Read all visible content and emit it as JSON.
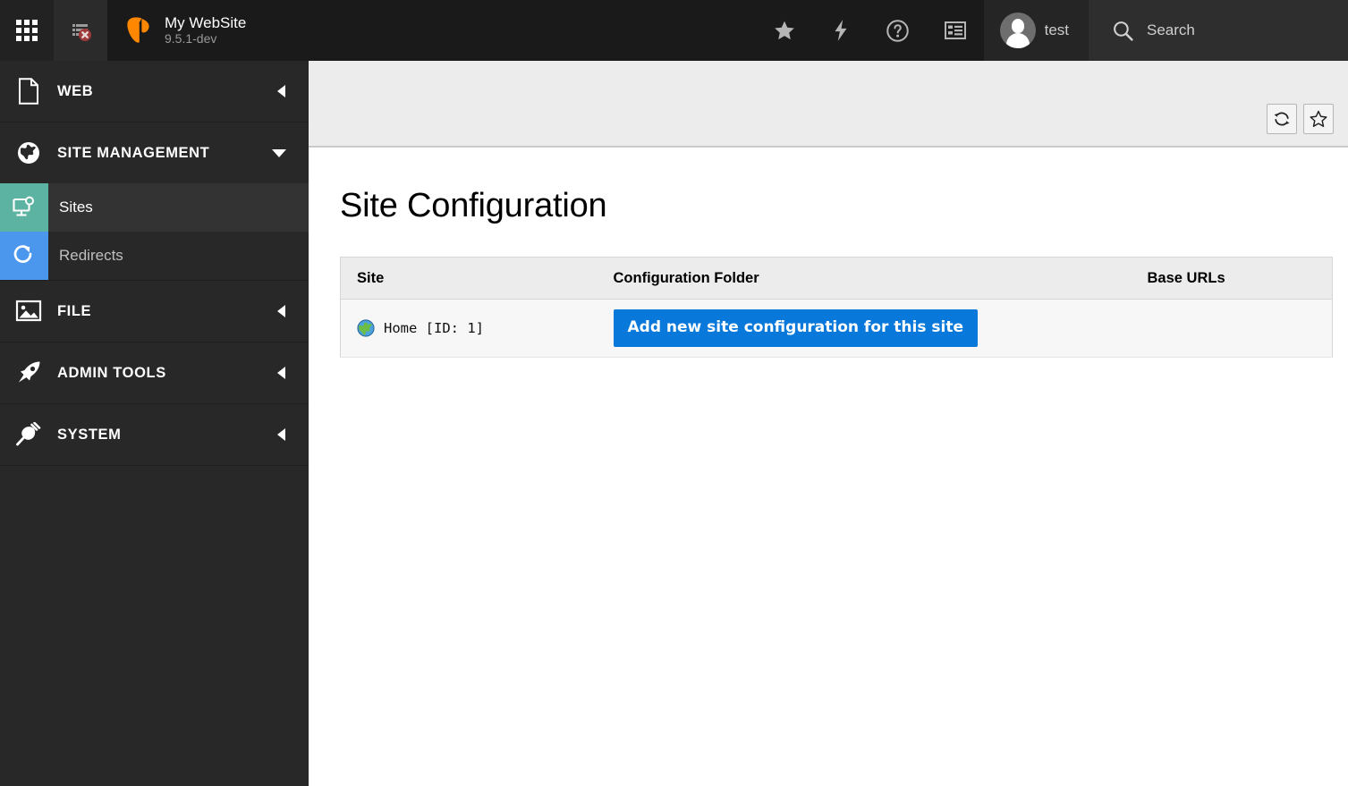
{
  "topbar": {
    "module_menu_icon": "grid-menu-icon",
    "clear_cache_icon": "clear-cache-icon",
    "logo_icon": "typo3-logo-icon",
    "site_name": "My WebSite",
    "version": "9.5.1-dev",
    "bookmarks_icon": "star-icon",
    "workspaces_icon": "lightning-bolt-icon",
    "help_icon": "question-circle-icon",
    "systeminfo_icon": "list-panel-icon",
    "avatar_icon": "user-avatar-icon",
    "username": "test",
    "search_icon": "search-icon",
    "search_placeholder": "Search"
  },
  "sidebar": {
    "groups": [
      {
        "label": "WEB",
        "icon": "page-document-icon",
        "caret": "caret-left-icon",
        "expanded": false,
        "items": []
      },
      {
        "label": "SITE MANAGEMENT",
        "icon": "globe-icon",
        "caret": "caret-down-icon",
        "expanded": true,
        "items": [
          {
            "label": "Sites",
            "icon": "monitor-gear-icon",
            "color": "#5CB3A2",
            "active": true
          },
          {
            "label": "Redirects",
            "icon": "refresh-arrow-icon",
            "color": "#4B97EE",
            "active": false
          }
        ]
      },
      {
        "label": "FILE",
        "icon": "image-file-icon",
        "caret": "caret-left-icon",
        "expanded": false,
        "items": []
      },
      {
        "label": "ADMIN TOOLS",
        "icon": "rocket-icon",
        "caret": "caret-left-icon",
        "expanded": false,
        "items": []
      },
      {
        "label": "SYSTEM",
        "icon": "power-plug-icon",
        "caret": "caret-left-icon",
        "expanded": false,
        "items": []
      }
    ]
  },
  "docheader": {
    "refresh_icon": "refresh-icon",
    "bookmark_icon": "star-outline-icon"
  },
  "main": {
    "title": "Site Configuration",
    "table": {
      "headers": [
        "Site",
        "Configuration Folder",
        "Base URLs"
      ],
      "rows": [
        {
          "site_icon": "globe-earth-icon",
          "site": "Home [ID: 1]",
          "configuration_folder_action": "Add new site configuration for this site",
          "base_urls": ""
        }
      ]
    }
  },
  "colors": {
    "accent_blue": "#0978DB",
    "typo3_orange": "#FF8700",
    "sites_tile": "#5CB3A2",
    "redirects_tile": "#4B97EE",
    "topbar_bg": "#1A1A1A",
    "sidebar_bg": "#282828",
    "docheader_bg": "#ECECEC"
  }
}
